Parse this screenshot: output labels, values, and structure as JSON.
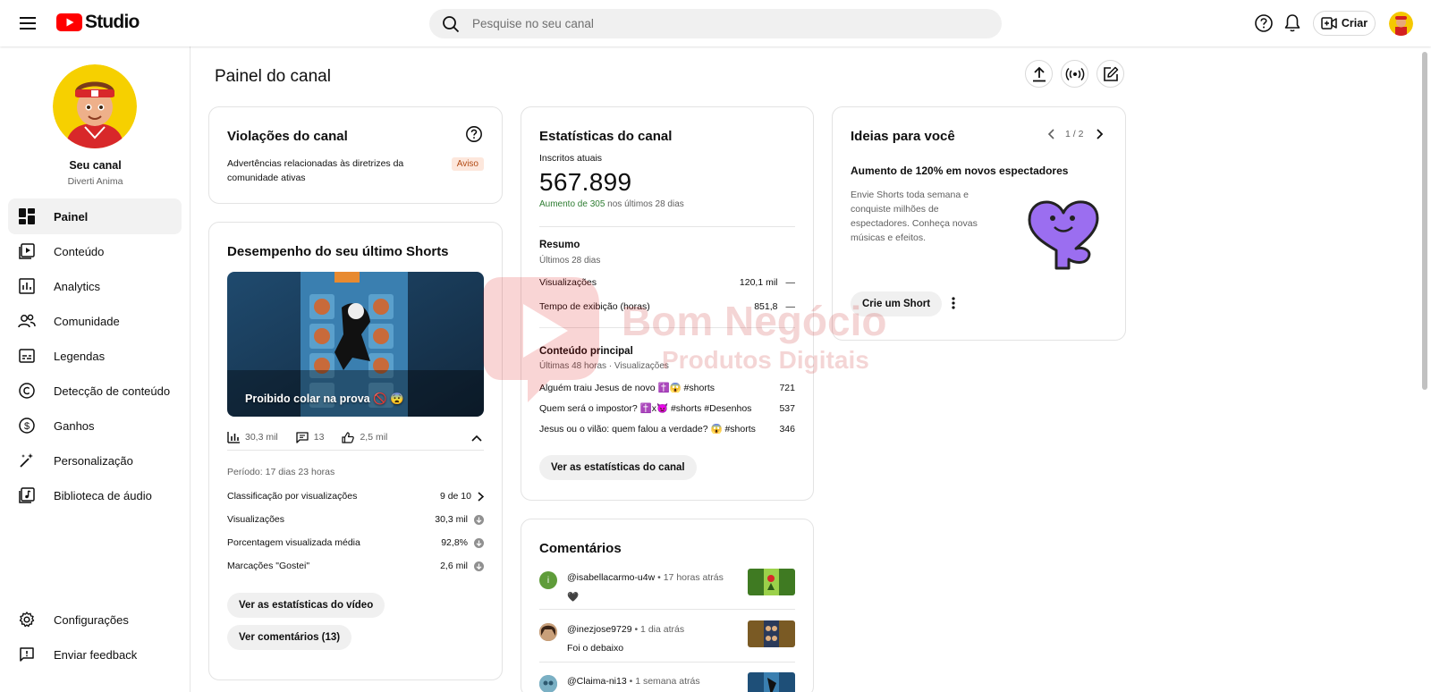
{
  "header": {
    "logo_text": "Studio",
    "search_placeholder": "Pesquise no seu canal",
    "create_label": "Criar"
  },
  "sidebar": {
    "channel_title": "Seu canal",
    "channel_name": "Diverti Anima",
    "items": [
      {
        "label": "Painel",
        "icon": "dashboard-icon",
        "active": true
      },
      {
        "label": "Conteúdo",
        "icon": "content-icon"
      },
      {
        "label": "Analytics",
        "icon": "analytics-icon"
      },
      {
        "label": "Comunidade",
        "icon": "community-icon"
      },
      {
        "label": "Legendas",
        "icon": "subtitles-icon"
      },
      {
        "label": "Detecção de conteúdo",
        "icon": "copyright-icon"
      },
      {
        "label": "Ganhos",
        "icon": "earn-icon"
      },
      {
        "label": "Personalização",
        "icon": "customization-icon"
      },
      {
        "label": "Biblioteca de áudio",
        "icon": "audio-library-icon"
      }
    ],
    "bottom_items": [
      {
        "label": "Configurações",
        "icon": "settings-icon"
      },
      {
        "label": "Enviar feedback",
        "icon": "feedback-icon"
      }
    ]
  },
  "main": {
    "page_title": "Painel do canal"
  },
  "violations": {
    "title": "Violações do canal",
    "description": "Advertências relacionadas às diretrizes da comunidade ativas",
    "badge": "Aviso"
  },
  "shorts": {
    "title": "Desempenho do seu último Shorts",
    "video_title": "Proibido colar na prova 🚫 😨",
    "views": "30,3 mil",
    "comments": "13",
    "likes": "2,5 mil",
    "period": "Período: 17 dias 23 horas",
    "rows": [
      {
        "label": "Classificação por visualizações",
        "value": "9 de 10"
      },
      {
        "label": "Visualizações",
        "value": "30,3 mil"
      },
      {
        "label": "Porcentagem visualizada média",
        "value": "92,8%"
      },
      {
        "label": "Marcações \"Gostei\"",
        "value": "2,6 mil"
      }
    ],
    "btn_video_stats": "Ver as estatísticas do vídeo",
    "btn_comments": "Ver comentários (13)"
  },
  "stats": {
    "title": "Estatísticas do canal",
    "subs_label": "Inscritos atuais",
    "subs_value": "567.899",
    "subs_increase": "Aumento de 305",
    "subs_increase_suffix": " nos últimos 28 dias",
    "summary_title": "Resumo",
    "summary_period": "Últimos 28 dias",
    "summary_rows": [
      {
        "label": "Visualizações",
        "value": "120,1 mil",
        "trend": "—"
      },
      {
        "label": "Tempo de exibição (horas)",
        "value": "851,8",
        "trend": "—"
      }
    ],
    "top_content_title": "Conteúdo principal",
    "top_content_period": "Últimas 48 horas · Visualizações",
    "top_content": [
      {
        "title": "Alguém traiu Jesus de novo ✝️😱 #shorts",
        "views": "721"
      },
      {
        "title": "Quem será o impostor? ✝️x👿 #shorts #Desenhos",
        "views": "537"
      },
      {
        "title": "Jesus ou o vilão: quem falou a verdade? 😱 #shorts",
        "views": "346"
      }
    ],
    "btn_channel_stats": "Ver as estatísticas do canal"
  },
  "comments": {
    "title": "Comentários",
    "items": [
      {
        "user": "@isabellacarmo-u4w",
        "time": "• 17 horas atrás",
        "text": "🖤",
        "avatar_letter": "i",
        "avatar_color": "#5f9c3a"
      },
      {
        "user": "@inezjose9729",
        "time": "• 1 dia atrás",
        "text": "Foi o debaixo",
        "avatar_letter": "",
        "avatar_color": "#8a6a4a"
      },
      {
        "user": "@Claima-ni13",
        "time": "• 1 semana atrás",
        "text": "",
        "avatar_letter": "",
        "avatar_color": "#5a8fa8"
      }
    ]
  },
  "ideas": {
    "title": "Ideias para você",
    "pager": "1 / 2",
    "headline": "Aumento de 120% em novos espectadores",
    "body": "Envie Shorts toda semana e conquiste milhões de espectadores. Conheça novas músicas e efeitos.",
    "btn_create_short": "Crie um Short"
  },
  "watermark": {
    "line1": "Bom Negócio",
    "line2": "Produtos Digitais"
  },
  "colors": {
    "brand_red": "#ff0000",
    "green": "#2e7d32",
    "badge_bg": "#fde7dc",
    "badge_text": "#b24a14"
  }
}
